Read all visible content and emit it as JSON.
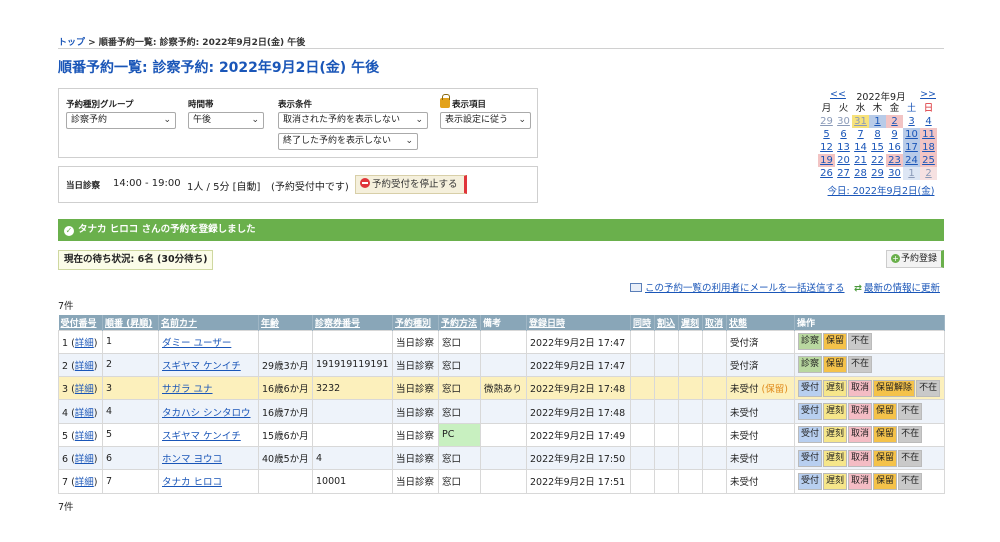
{
  "breadcrumb": {
    "top": "トップ",
    "sep": ">",
    "current": "順番予約一覧: 診察予約: 2022年9月2日(金) 午後"
  },
  "page_title": "順番予約一覧: 診察予約: 2022年9月2日(金) 午後",
  "filters": {
    "group_label": "予約種別グループ",
    "group_value": "診察予約",
    "time_label": "時間帯",
    "time_value": "午後",
    "cond_label": "表示条件",
    "cond_value1": "取消された予約を表示しない",
    "cond_value2": "終了した予約を表示しない",
    "items_label": "表示項目",
    "items_value": "表示設定に従う"
  },
  "today": {
    "label": "当日診察",
    "time": "14:00 - 19:00",
    "capacity": "1人 / 5分 [自動]",
    "status": "(予約受付中です)",
    "stop_label": "予約受付を停止する"
  },
  "calendar": {
    "prev": "<<",
    "month": "2022年9月",
    "next": ">>",
    "dow": [
      "月",
      "火",
      "水",
      "木",
      "金",
      "土",
      "日"
    ],
    "dow_colors": [
      "#222",
      "#222",
      "#222",
      "#222",
      "#222",
      "#1a56b8",
      "#d9262c"
    ],
    "weeks": [
      [
        "29",
        "30",
        "31",
        "1",
        "2",
        "3",
        "4"
      ],
      [
        "5",
        "6",
        "7",
        "8",
        "9",
        "10",
        "11"
      ],
      [
        "12",
        "13",
        "14",
        "15",
        "16",
        "17",
        "18"
      ],
      [
        "19",
        "20",
        "21",
        "22",
        "23",
        "24",
        "25"
      ],
      [
        "26",
        "27",
        "28",
        "29",
        "30",
        "1",
        "2"
      ]
    ],
    "today_link": "今日: 2022年9月2日(金)"
  },
  "success_message": "タナカ ヒロコ さんの予約を登録しました",
  "wait_status": "現在の待ち状況: 6名 (30分待ち)",
  "register_label": "予約登録",
  "mail_link": "この予約一覧の利用者にメールを一括送信する",
  "refresh_link": "最新の情報に更新",
  "count": "7件",
  "table": {
    "headers": [
      "受付番号",
      "順番 (昇順)",
      "名前カナ",
      "年齢",
      "診察券番号",
      "予約種別",
      "予約方法",
      "備考",
      "登録日時",
      "同時",
      "割込",
      "遅刻",
      "取消",
      "状態",
      "操作"
    ],
    "rows": [
      {
        "no": "1",
        "detail": "詳細",
        "order": "1",
        "name": "ダミー ユーザー",
        "age": "",
        "card": "",
        "type": "当日診察",
        "method": "窓口",
        "note": "",
        "date": "2022年9月2日 17:47",
        "state": "受付済",
        "state_extra": "",
        "actions": [
          "診察",
          "保留",
          "不在"
        ]
      },
      {
        "no": "2",
        "detail": "詳細",
        "order": "2",
        "name": "スギヤマ ケンイチ",
        "age": "29歳3か月",
        "card": "191919119191",
        "type": "当日診察",
        "method": "窓口",
        "note": "",
        "date": "2022年9月2日 17:47",
        "state": "受付済",
        "state_extra": "",
        "actions": [
          "診察",
          "保留",
          "不在"
        ]
      },
      {
        "no": "3",
        "detail": "詳細",
        "order": "3",
        "name": "サガラ ユナ",
        "age": "16歳6か月",
        "card": "3232",
        "type": "当日診察",
        "method": "窓口",
        "note": "微熱あり",
        "date": "2022年9月2日 17:48",
        "state": "未受付",
        "state_extra": "(保留)",
        "actions": [
          "受付",
          "遅刻",
          "取消",
          "保留解除",
          "不在"
        ]
      },
      {
        "no": "4",
        "detail": "詳細",
        "order": "4",
        "name": "タカハシ シンタロウ",
        "age": "16歳7か月",
        "card": "",
        "type": "当日診察",
        "method": "窓口",
        "note": "",
        "date": "2022年9月2日 17:48",
        "state": "未受付",
        "state_extra": "",
        "actions": [
          "受付",
          "遅刻",
          "取消",
          "保留",
          "不在"
        ]
      },
      {
        "no": "5",
        "detail": "詳細",
        "order": "5",
        "name": "スギヤマ ケンイチ",
        "age": "15歳6か月",
        "card": "",
        "type": "当日診察",
        "method": "PC",
        "note": "",
        "date": "2022年9月2日 17:49",
        "state": "未受付",
        "state_extra": "",
        "actions": [
          "受付",
          "遅刻",
          "取消",
          "保留",
          "不在"
        ]
      },
      {
        "no": "6",
        "detail": "詳細",
        "order": "6",
        "name": "ホンマ ヨウコ",
        "age": "40歳5か月",
        "card": "4",
        "type": "当日診察",
        "method": "窓口",
        "note": "",
        "date": "2022年9月2日 17:50",
        "state": "未受付",
        "state_extra": "",
        "actions": [
          "受付",
          "遅刻",
          "取消",
          "保留",
          "不在"
        ]
      },
      {
        "no": "7",
        "detail": "詳細",
        "order": "7",
        "name": "タナカ ヒロコ",
        "age": "",
        "card": "10001",
        "type": "当日診察",
        "method": "窓口",
        "note": "",
        "date": "2022年9月2日 17:51",
        "state": "未受付",
        "state_extra": "",
        "actions": [
          "受付",
          "遅刻",
          "取消",
          "保留",
          "不在"
        ]
      }
    ]
  }
}
